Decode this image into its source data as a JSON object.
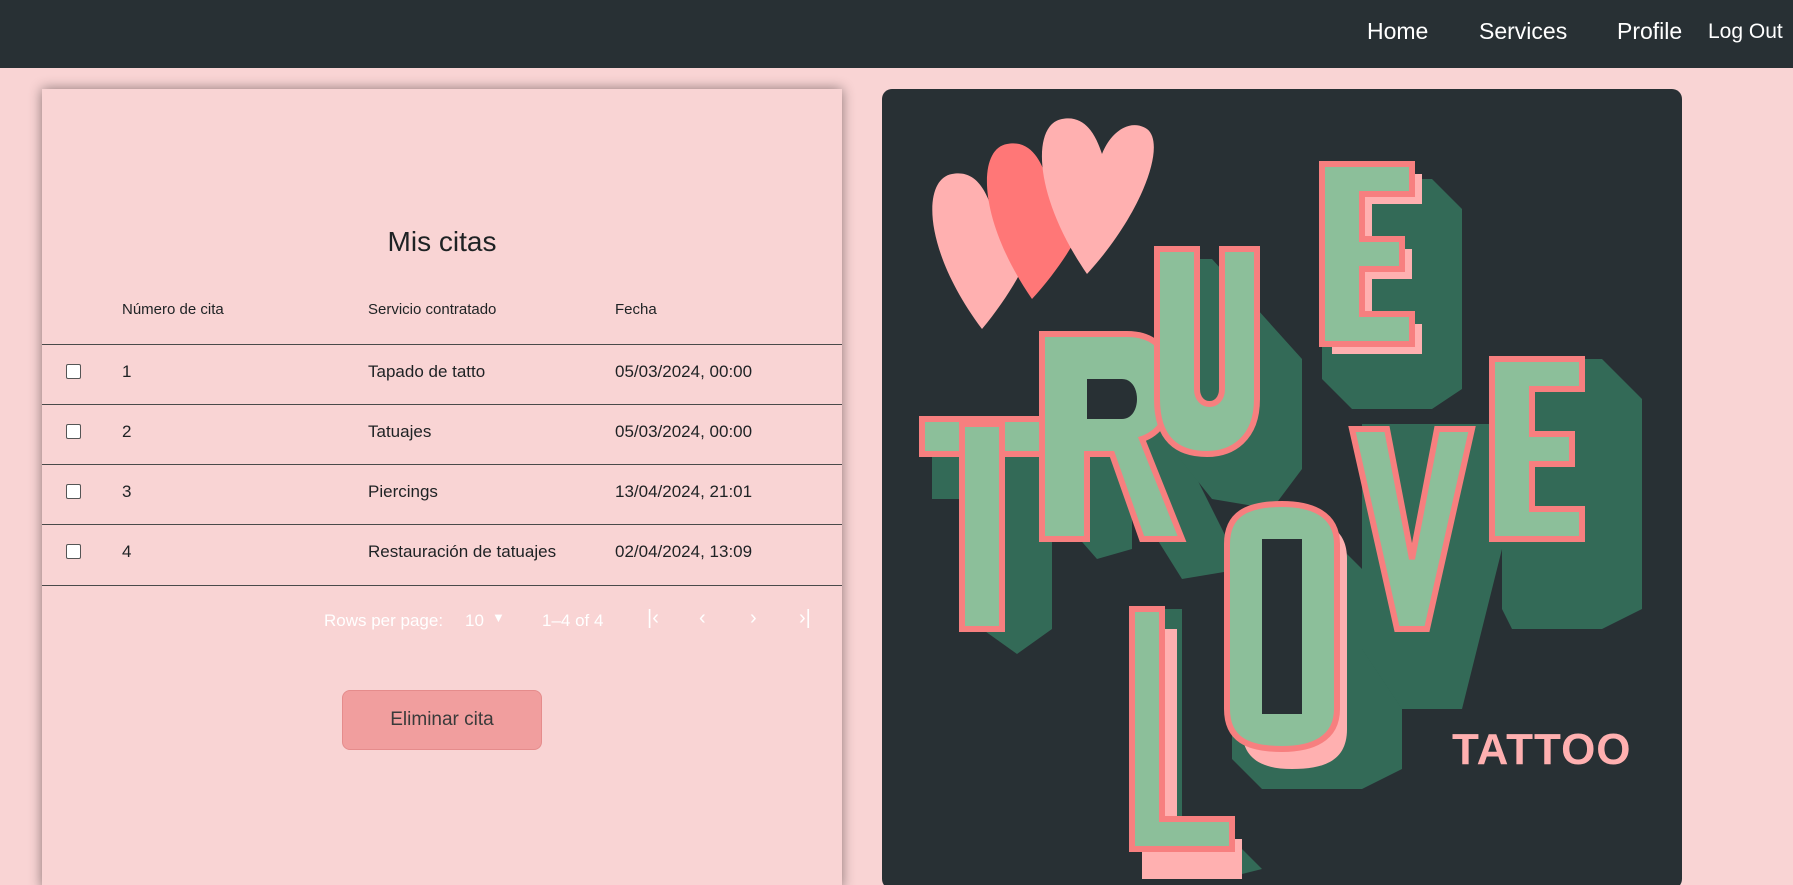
{
  "nav": {
    "home": "Home",
    "services": "Services",
    "profile": "Profile",
    "logout": "Log Out"
  },
  "appointments": {
    "title": "Mis citas",
    "columns": [
      "Número de cita",
      "Servicio contratado",
      "Fecha"
    ],
    "rows": [
      {
        "num": "1",
        "service": "Tapado de tatto",
        "date": "05/03/2024, 00:00"
      },
      {
        "num": "2",
        "service": "Tatuajes",
        "date": "05/03/2024, 00:00"
      },
      {
        "num": "3",
        "service": "Piercings",
        "date": "13/04/2024, 21:01"
      },
      {
        "num": "4",
        "service": "Restauración de tatuajes",
        "date": "02/04/2024, 13:09"
      }
    ],
    "pagination": {
      "rows_per_page_label": "Rows per page:",
      "rows_per_page_value": "10",
      "range": "1–4 of 4"
    },
    "delete_button": "Eliminar cita"
  },
  "poster": {
    "word1": "TRUE",
    "word2": "LOVE",
    "word3": "TATTOO",
    "colors": {
      "background": "#283034",
      "letter_face": "#8cbf9a",
      "letter_outline": "#f77f7f",
      "letter_side": "#336a57",
      "shadow": "#ffb0b0",
      "heart_light": "#ffb0b0",
      "heart_dark": "#ff7777"
    }
  },
  "colors": {
    "navbar": "#283034",
    "page_background": "#f9d4d4",
    "button": "#f19e9e"
  }
}
